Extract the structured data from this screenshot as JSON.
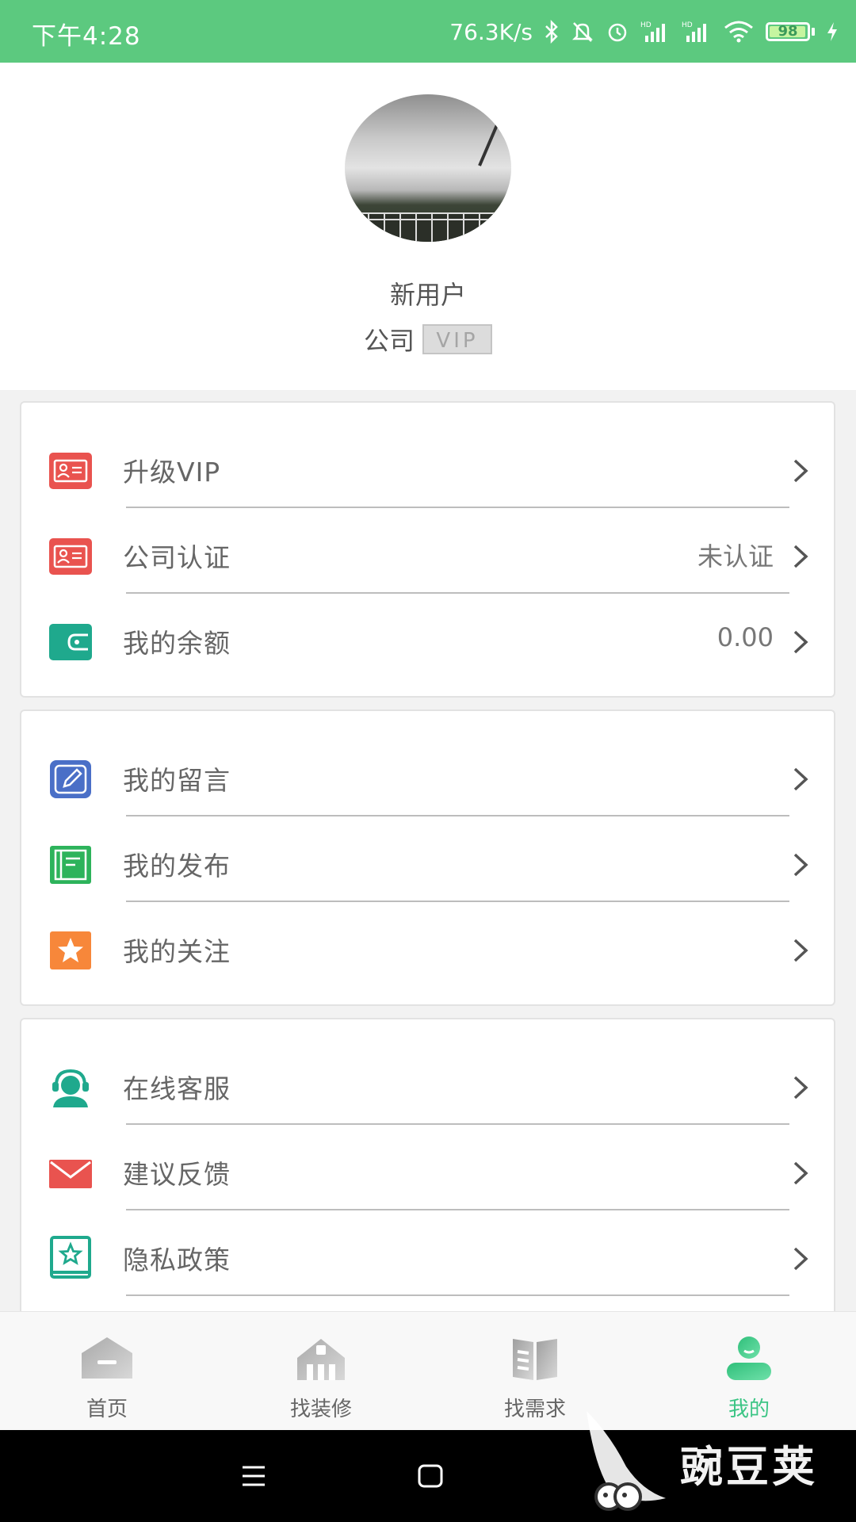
{
  "status_bar": {
    "time": "下午4:28",
    "net_speed": "76.3K/s",
    "hd1": "HD",
    "hd2": "HD",
    "battery": "98",
    "battery_level": 0.98
  },
  "profile": {
    "username": "新用户",
    "role": "公司",
    "vip_badge": "VIP"
  },
  "menu_group_1": [
    {
      "label": "升级VIP",
      "value": "",
      "icon": "id-card-icon",
      "color": "#e9534f"
    },
    {
      "label": "公司认证",
      "value": "未认证",
      "icon": "id-card-icon",
      "color": "#e9534f"
    },
    {
      "label": "我的余额",
      "value": "0.00",
      "icon": "wallet-icon",
      "color": "#1fa98d"
    }
  ],
  "menu_group_2": [
    {
      "label": "我的留言",
      "icon": "edit-note-icon",
      "color": "#4a6fc7"
    },
    {
      "label": "我的发布",
      "icon": "notebook-icon",
      "color": "#2db35b"
    },
    {
      "label": "我的关注",
      "icon": "star-icon",
      "color": "#f7873a"
    }
  ],
  "menu_group_3": [
    {
      "label": "在线客服",
      "icon": "customer-service-icon",
      "color": "#1fa98d"
    },
    {
      "label": "建议反馈",
      "icon": "mail-icon",
      "color": "#e9534f"
    },
    {
      "label": "隐私政策",
      "icon": "privacy-book-icon",
      "color": "#1fa98d"
    }
  ],
  "tab_bar": [
    {
      "label": "首页",
      "icon": "home-icon",
      "active": false
    },
    {
      "label": "找装修",
      "icon": "building-icon",
      "active": false
    },
    {
      "label": "找需求",
      "icon": "book-icon",
      "active": false
    },
    {
      "label": "我的",
      "icon": "user-icon",
      "active": true
    }
  ],
  "watermark": "豌豆荚",
  "colors": {
    "status_bar": "#5cc97f",
    "accent": "#3cc585",
    "red": "#e9534f",
    "teal": "#1fa98d",
    "blue": "#4a6fc7",
    "green": "#2db35b",
    "orange": "#f7873a"
  }
}
